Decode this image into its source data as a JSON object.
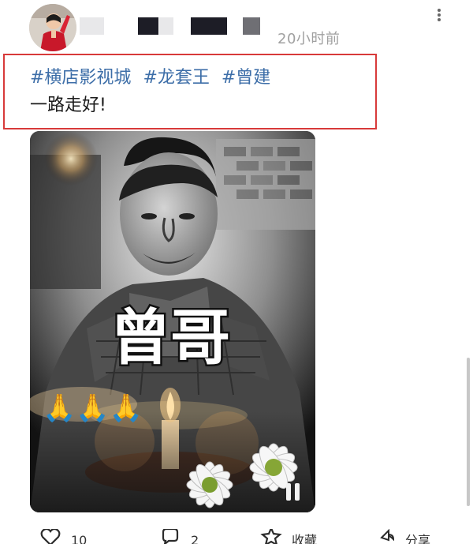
{
  "header": {
    "timestamp": "20小时前"
  },
  "post": {
    "hashtags": [
      "#横店影视城",
      "#龙套王",
      "#曾建"
    ],
    "body": "一路走好!"
  },
  "media": {
    "caption": "曾哥",
    "emojis": "🙏🙏🙏"
  },
  "actions": {
    "like_count": "10",
    "comment_count": "2",
    "favorite_label": "收藏",
    "share_label": "分享"
  },
  "colors": {
    "hashtag": "#3d6ea8",
    "highlight": "#d83a3a",
    "timestamp": "#a0a0a0"
  },
  "icons": [
    "more-icon",
    "heart-icon",
    "comment-icon",
    "star-icon",
    "share-icon",
    "pause-icon"
  ]
}
